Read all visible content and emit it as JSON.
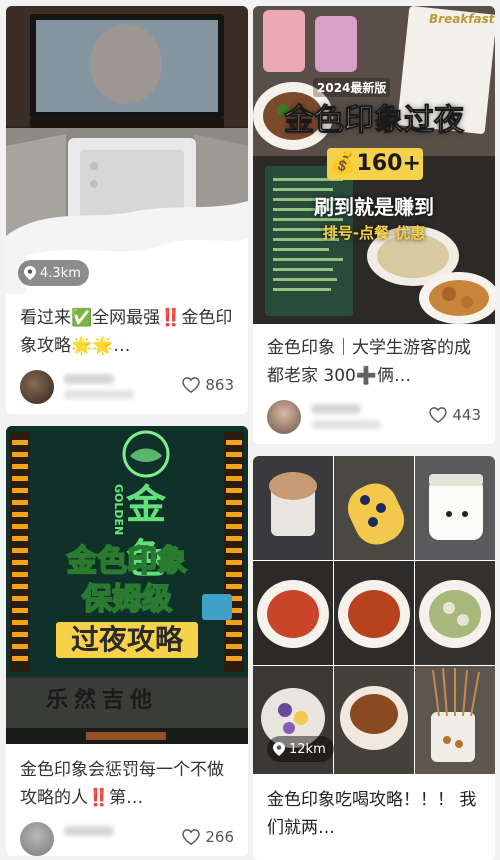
{
  "cards": [
    {
      "title": "看过来✅全网最强‼️金色印象攻略🌟🌟…",
      "location": "4.3km",
      "likes": "863",
      "liked": false
    },
    {
      "title": "金色印象｜大学生游客的成都老家 300➕俩…",
      "overlay": {
        "banner": "Breakfast",
        "badge": "2024最新版",
        "headline": "金色印象过夜",
        "price": "💰160+",
        "line1": "刷到就是赚到",
        "line2": "排号-点餐-优惠"
      },
      "likes": "443",
      "liked": false
    },
    {
      "title": "金色印象会惩罚每一个不做攻略的人‼️第…",
      "overlay": {
        "sign_vertical": "GOLDEN",
        "line1": "金色印象",
        "line2": "保姆级",
        "line3": "过夜攻略",
        "shop": "乐然吉他"
      },
      "likes": "266",
      "liked": false
    },
    {
      "title": "金色印象吃喝攻略！！！ 我们就两…",
      "location": "12km"
    }
  ],
  "colors": {
    "title_text": "#333333",
    "meta_text": "#555555",
    "accent_yellow": "#f6d24a",
    "accent_green": "#6bd46a"
  }
}
